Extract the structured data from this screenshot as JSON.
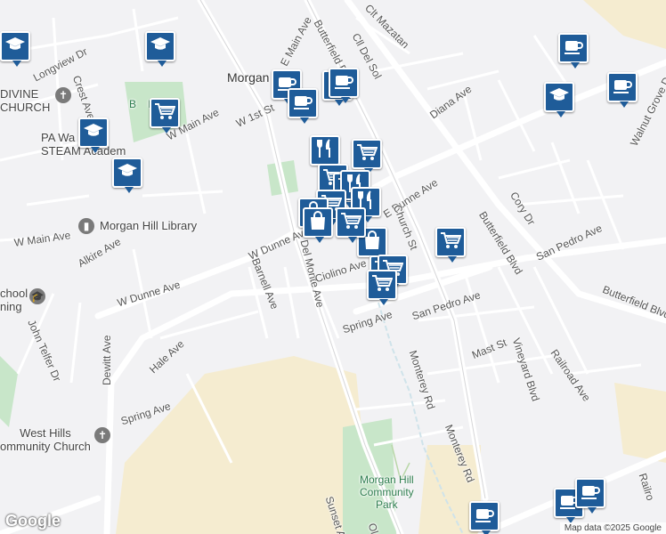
{
  "map": {
    "city_label": "Morgan",
    "streets": [
      "E Main Ave",
      "Butterfield Blvd",
      "Butterfield Blvd",
      "Butterfield Blvd",
      "Clt Mazatan",
      "Cll Del Sol",
      "Longview Dr",
      "Crest Ave",
      "W 1st St",
      "W Main Ave",
      "W Main Ave",
      "Diana Ave",
      "Walnut Grove Dr",
      "E Dunne Ave",
      "Church St",
      "Cory Dr",
      "San Pedro Ave",
      "San Pedro Ave",
      "W Dunne Ave",
      "W Dunne Ave",
      "Del Monte Ave",
      "Ciolino Ave",
      "Barnell Ave",
      "Alkire Ave",
      "Spring Ave",
      "Spring Ave",
      "John Telfer Dr",
      "Hale Ave",
      "Dewitt Ave",
      "Mast St",
      "Vineyard Blvd",
      "Railroad Ave",
      "Monterey Rd",
      "Monterey Rd",
      "Sunset A",
      "Ol",
      "Railro"
    ],
    "places": {
      "church1": "DIVINE\nCHURCH",
      "academy": "PA Wa\nSTEAM Academ",
      "field": "B    Field",
      "library": "Morgan Hill Library",
      "school": "chool\nning",
      "church2": "West Hills\nommunity Church",
      "park": "Morgan Hill\nCommunity\nPark"
    },
    "pins": [
      {
        "icon": "school"
      },
      {
        "icon": "school"
      },
      {
        "icon": "shopping-cart"
      },
      {
        "icon": "school"
      },
      {
        "icon": "school"
      },
      {
        "icon": "coffee"
      },
      {
        "icon": "coffee"
      },
      {
        "icon": "coffee"
      },
      {
        "icon": "coffee"
      },
      {
        "icon": "coffee"
      },
      {
        "icon": "school"
      },
      {
        "icon": "restaurant"
      },
      {
        "icon": "shopping-cart"
      },
      {
        "icon": "shopping-cart"
      },
      {
        "icon": "shopping-cart"
      },
      {
        "icon": "restaurant"
      },
      {
        "icon": "restaurant"
      },
      {
        "icon": "shopping-cart"
      },
      {
        "icon": "shopping-bag"
      },
      {
        "icon": "shopping-bag"
      },
      {
        "icon": "shopping-bag"
      },
      {
        "icon": "shopping-cart"
      },
      {
        "icon": "shopping-cart"
      },
      {
        "icon": "shopping-cart"
      },
      {
        "icon": "shopping-cart"
      },
      {
        "icon": "shopping-cart"
      },
      {
        "icon": "coffee"
      },
      {
        "icon": "coffee"
      },
      {
        "icon": "coffee"
      },
      {
        "icon": "coffee"
      }
    ],
    "attribution": "Map data ©2025 Google",
    "logo": "Google",
    "colors": {
      "pin": "#1f5c99",
      "park": "#c8e6c9",
      "road": "#ffffff",
      "sand": "#f5ecd0"
    }
  }
}
